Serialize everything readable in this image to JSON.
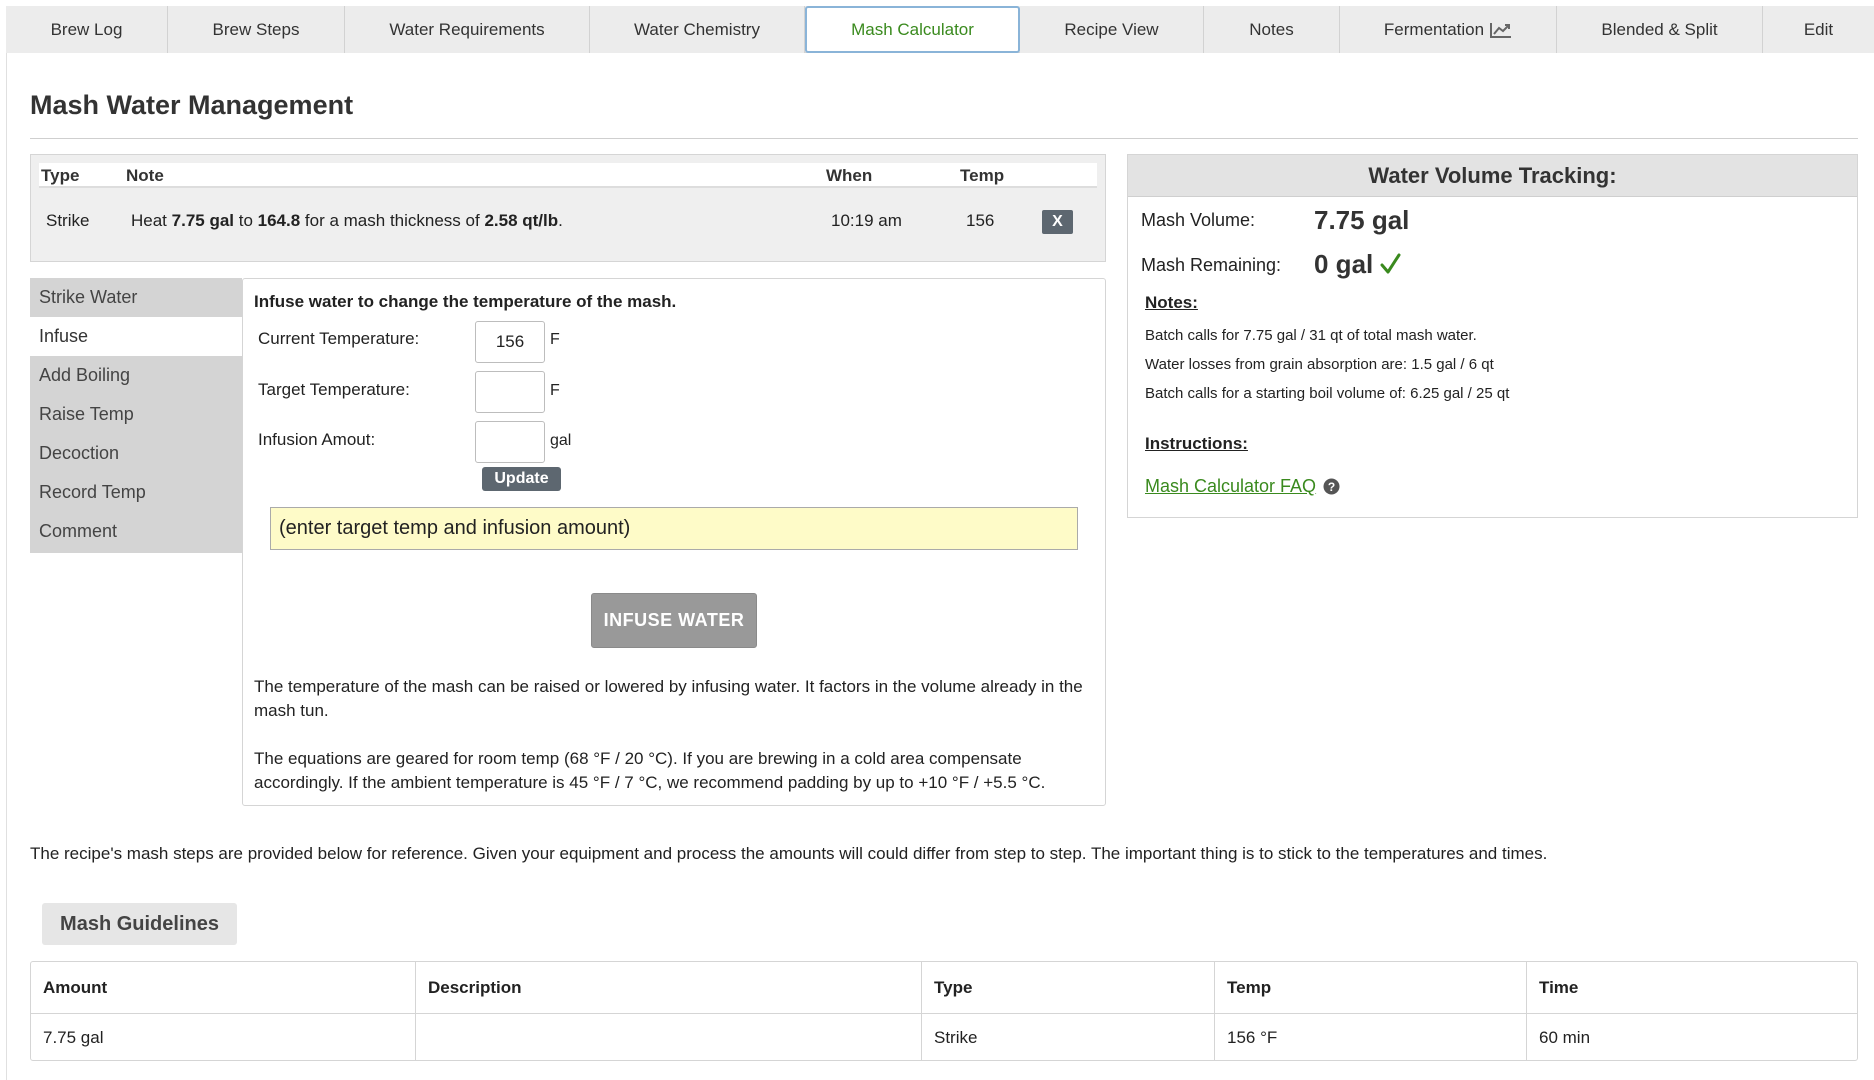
{
  "tabs": [
    {
      "label": "Brew Log"
    },
    {
      "label": "Brew Steps"
    },
    {
      "label": "Water Requirements"
    },
    {
      "label": "Water Chemistry"
    },
    {
      "label": "Mash Calculator",
      "active": true
    },
    {
      "label": "Recipe View"
    },
    {
      "label": "Notes"
    },
    {
      "label": "Fermentation",
      "icon": "line-chart-icon"
    },
    {
      "label": "Blended & Split"
    },
    {
      "label": "Edit"
    }
  ],
  "page_title": "Mash Water Management",
  "log_table": {
    "headers": {
      "type": "Type",
      "note": "Note",
      "when": "When",
      "temp": "Temp"
    },
    "rows": [
      {
        "type": "Strike",
        "note_parts": {
          "p1": "Heat ",
          "amount": "7.75 gal",
          "p2": " to ",
          "target": "164.8",
          "p3": " for a mash thickness of ",
          "thickness": "2.58 qt/lb",
          "p4": "."
        },
        "when": "10:19 am",
        "temp": "156",
        "delete_label": "X"
      }
    ]
  },
  "side_menu": {
    "items": [
      "Strike Water",
      "Infuse",
      "Add Boiling",
      "Raise Temp",
      "Decoction",
      "Record Temp",
      "Comment"
    ],
    "active": "Infuse"
  },
  "infuse_panel": {
    "heading": "Infuse water to change the temperature of the mash.",
    "current_temp_label": "Current Temperature:",
    "current_temp_value": "156",
    "current_temp_unit": "F",
    "target_temp_label": "Target Temperature:",
    "target_temp_value": "",
    "target_temp_unit": "F",
    "infusion_label": "Infusion Amout:",
    "infusion_value": "",
    "infusion_unit": "gal",
    "update_label": "Update",
    "result_text": "(enter target temp and infusion amount)",
    "infuse_button": "INFUSE WATER",
    "para1": "The temperature of the mash can be raised or lowered by infusing water. It factors in the volume already in the mash tun.",
    "para2": "The equations are geared for room temp (68 °F / 20 °C). If you are brewing in a cold area compensate accordingly. If the ambient temperature is 45 °F / 7 °C, we recommend padding by up to +10 °F / +5.5 °C."
  },
  "water_tracking": {
    "title": "Water Volume Tracking:",
    "mash_volume_label": "Mash Volume:",
    "mash_volume_value": "7.75 gal",
    "mash_remaining_label": "Mash Remaining:",
    "mash_remaining_value": "0 gal",
    "check_color": "#3a8a1e",
    "notes_heading": "Notes:",
    "notes": [
      "Batch calls for 7.75 gal / 31 qt of total mash water.",
      "Water losses from grain absorption are: 1.5 gal / 6 qt",
      "Batch calls for a starting boil volume of: 6.25 gal / 25 qt"
    ],
    "instructions_heading": "Instructions:",
    "faq_link": "Mash Calculator FAQ"
  },
  "reference_text": "The recipe's mash steps are provided below for reference. Given your equipment and process the amounts will could differ from step to step. The important thing is to stick to the temperatures and times.",
  "mash_guidelines": {
    "button_label": "Mash Guidelines",
    "headers": [
      "Amount",
      "Description",
      "Type",
      "Temp",
      "Time"
    ],
    "rows": [
      [
        "7.75 gal",
        "",
        "Strike",
        "156 °F",
        "60 min"
      ]
    ]
  },
  "colors": {
    "accent_green": "#3a8a1e",
    "result_bg": "#fefbc8",
    "button_dark": "#5d6770",
    "tab_active_border": "#8ab4d8"
  }
}
